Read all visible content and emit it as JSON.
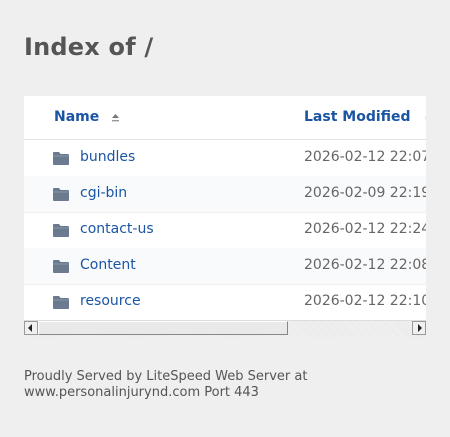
{
  "page": {
    "title": "Index of /"
  },
  "table": {
    "columns": {
      "name": "Name",
      "last_modified": "Last Modified"
    },
    "rows": [
      {
        "name": "bundles",
        "modified": "2026-02-12 22:07"
      },
      {
        "name": "cgi-bin",
        "modified": "2026-02-09 22:19"
      },
      {
        "name": "contact-us",
        "modified": "2026-02-12 22:24"
      },
      {
        "name": "Content",
        "modified": "2026-02-12 22:08"
      },
      {
        "name": "resource",
        "modified": "2026-02-12 22:10"
      }
    ],
    "sort": {
      "column": "name",
      "direction": "ascending"
    }
  },
  "footer": {
    "line1": "Proudly Served by LiteSpeed Web Server at",
    "line2": "www.personalinjurynd.com Port 443"
  },
  "colors": {
    "link": "#1a55a4",
    "background": "#efefef",
    "panel": "#ffffff"
  }
}
